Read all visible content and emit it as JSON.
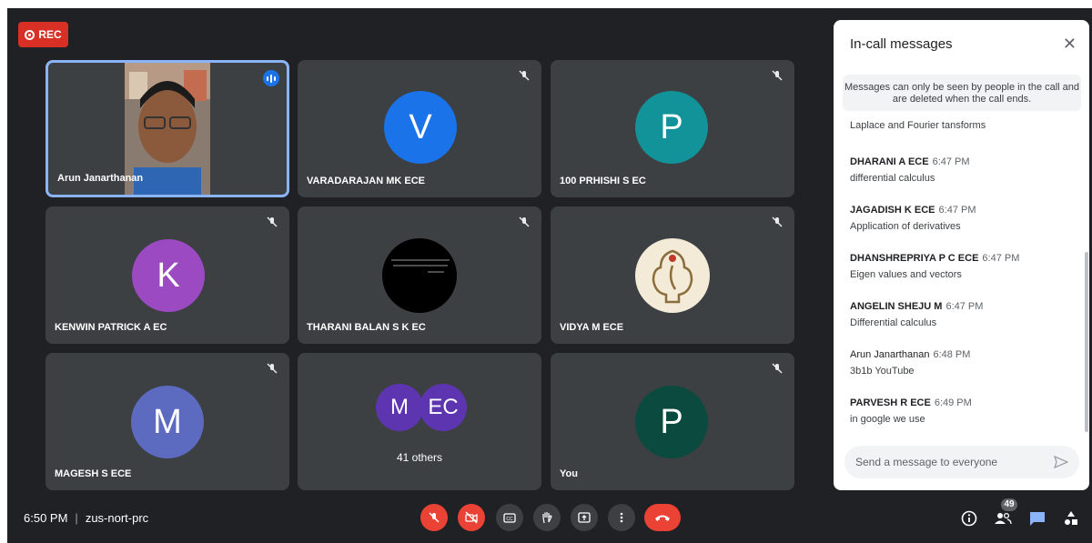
{
  "recording": {
    "label": "REC"
  },
  "tiles": [
    {
      "name": "Arun Janarthanan"
    },
    {
      "name": "VARADARAJAN MK ECE",
      "initial": "V",
      "color": "#1a73e8"
    },
    {
      "name": "100 PRHISHI S EC",
      "initial": "P",
      "color": "#12939a"
    },
    {
      "name": "KENWIN PATRICK A EC",
      "initial": "K",
      "color": "#9c4ac2"
    },
    {
      "name": "THARANI BALAN S K EC"
    },
    {
      "name": "VIDYA M ECE"
    },
    {
      "name": "MAGESH S ECE",
      "initial": "M",
      "color": "#5c6bc0"
    },
    {
      "name": "You",
      "initial": "P",
      "color": "#0b4a3f"
    }
  ],
  "others": {
    "initials": [
      "M",
      "EC"
    ],
    "label": "41 others",
    "color": "#5e35b1"
  },
  "footer": {
    "time": "6:50 PM",
    "meeting_code": "zus-nort-prc",
    "people_count": "49"
  },
  "chat": {
    "title": "In-call messages",
    "close": "✕",
    "notice": "Messages can only be seen by people in the call and are deleted when the call ends.",
    "partial_top": "Laplace and Fourier tansforms",
    "messages": [
      {
        "sender": "DHARANI A ECE",
        "time": "6:47 PM",
        "text": "differential calculus"
      },
      {
        "sender": "JAGADISH K ECE",
        "time": "6:47 PM",
        "text": "Application of derivatives"
      },
      {
        "sender": "DHANSHREPRIYA P C ECE",
        "time": "6:47 PM",
        "text": "Eigen values and vectors"
      },
      {
        "sender": "ANGELIN SHEJU M",
        "time": "6:47 PM",
        "text": "Differential calculus"
      },
      {
        "sender": "Arun Janarthanan",
        "time": "6:48 PM",
        "text": "3b1b YouTube"
      },
      {
        "sender": "PARVESH R ECE",
        "time": "6:49 PM",
        "text": "in google we use"
      }
    ],
    "input_placeholder": "Send a message to everyone"
  }
}
